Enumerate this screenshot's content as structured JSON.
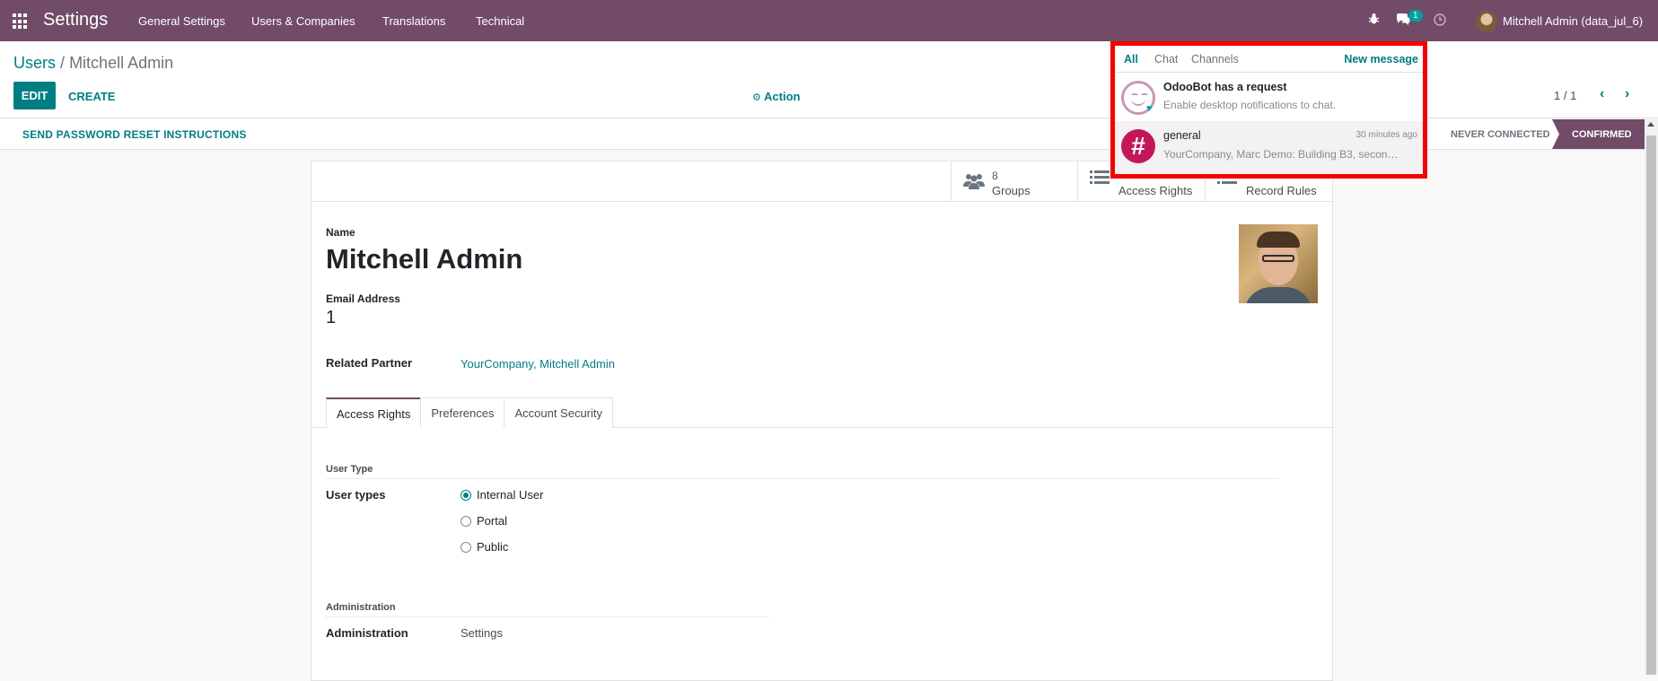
{
  "navbar": {
    "brand": "Settings",
    "menu": [
      "General Settings",
      "Users & Companies",
      "Translations",
      "Technical"
    ],
    "messaging_badge": "1",
    "user_name": "Mitchell Admin (data_jul_6)"
  },
  "breadcrumb": {
    "parent": "Users",
    "separator": "/",
    "current": "Mitchell Admin"
  },
  "toolbar": {
    "edit_label": "EDIT",
    "create_label": "CREATE",
    "action_label": "Action",
    "pager": "1 / 1"
  },
  "statusbar": {
    "reset_label": "SEND PASSWORD RESET INSTRUCTIONS",
    "stages": [
      "NEVER CONNECTED",
      "CONFIRMED"
    ],
    "active_stage": "CONFIRMED"
  },
  "stat_buttons": {
    "groups_count": "8",
    "groups_label": "Groups",
    "access_rights_label": "Access Rights",
    "record_rules_label": "Record Rules"
  },
  "form": {
    "name_label": "Name",
    "name_value": "Mitchell Admin",
    "email_label": "Email Address",
    "email_value": "1",
    "partner_label": "Related Partner",
    "partner_value": "YourCompany, Mitchell Admin",
    "tabs": [
      "Access Rights",
      "Preferences",
      "Account Security"
    ],
    "active_tab": "Access Rights",
    "user_type_section": "User Type",
    "user_types_label": "User types",
    "user_type_options": [
      "Internal User",
      "Portal",
      "Public"
    ],
    "user_type_selected": "Internal User",
    "administration_section": "Administration",
    "administration_label": "Administration",
    "administration_value": "Settings"
  },
  "messaging": {
    "tabs": [
      "All",
      "Chat",
      "Channels"
    ],
    "active_tab": "All",
    "new_message_label": "New message",
    "items": [
      {
        "title": "OdooBot has a request",
        "preview": "Enable desktop notifications to chat.",
        "time": ""
      },
      {
        "title": "general",
        "preview": "YourCompany, Marc Demo: Building B3, secon…",
        "time": "30 minutes ago"
      }
    ]
  },
  "colors": {
    "brand": "#714b67",
    "accent": "#017e84",
    "highlight_border": "#f40000"
  }
}
